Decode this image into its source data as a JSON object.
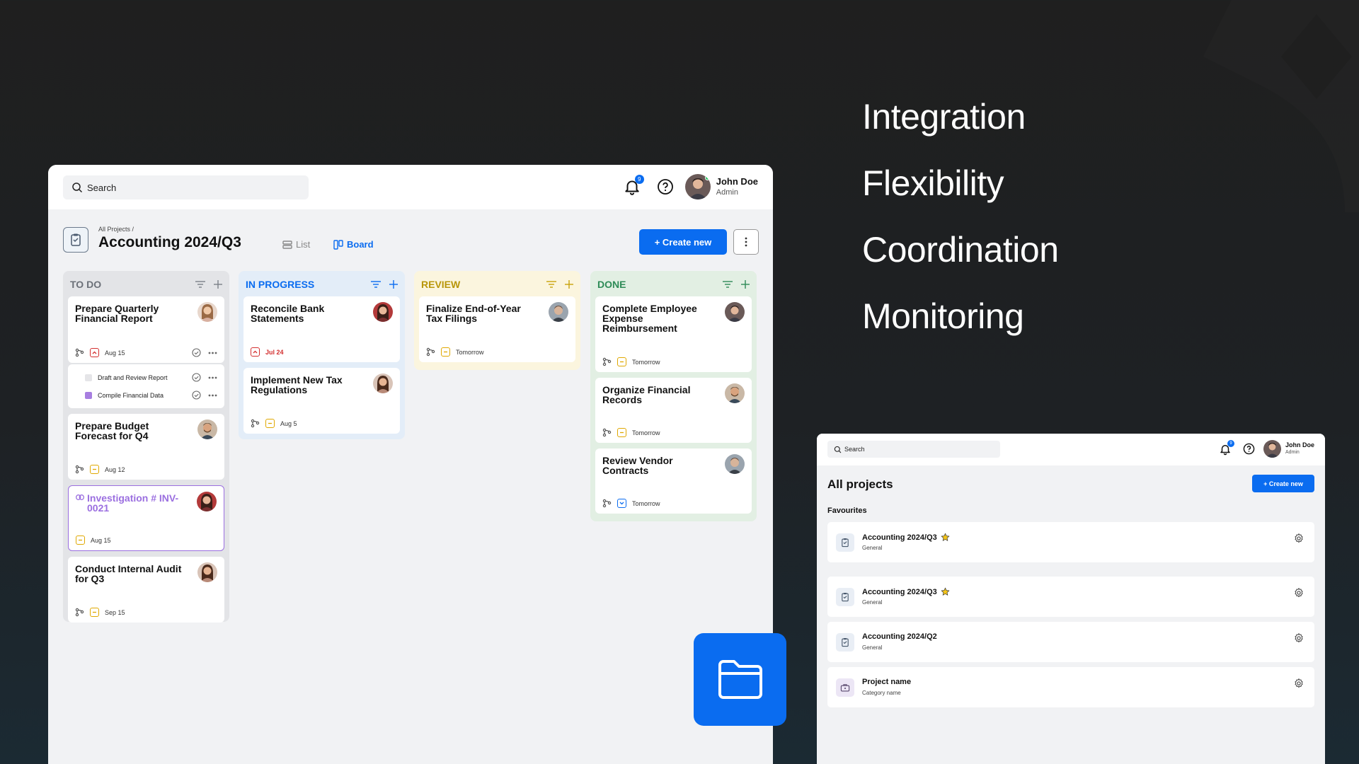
{
  "features": [
    "Integration",
    "Flexibility",
    "Coordination",
    "Monitoring"
  ],
  "colors": {
    "accent": "#0a6cf0",
    "todo": "#8a8f96",
    "in_progress": "#0a6cf0",
    "review": "#b8960a",
    "done": "#2e8b57"
  },
  "main": {
    "search_placeholder": "Search",
    "notifications_count": "9",
    "user": {
      "name": "John Doe",
      "role": "Admin"
    },
    "breadcrumb": "All Projects /",
    "project_title": "Accounting 2024/Q3",
    "views": {
      "list": "List",
      "board": "Board"
    },
    "create_label": "+ Create new",
    "columns": [
      {
        "title": "TO DO",
        "cards": [
          {
            "title": "Prepare Quarterly Financial Report",
            "date": "Aug 15",
            "subtasks": [
              "Draft and Review Report",
              "Compile Financial Data"
            ]
          },
          {
            "title": "Prepare Budget Forecast for Q4",
            "date": "Aug 12"
          },
          {
            "title": "Investigation # INV-0021",
            "date": "Aug 15"
          },
          {
            "title": "Conduct Internal Audit for Q3",
            "date": "Sep 15"
          }
        ]
      },
      {
        "title": "IN PROGRESS",
        "cards": [
          {
            "title": "Reconcile Bank Statements",
            "date": "Jul 24"
          },
          {
            "title": "Implement New Tax Regulations",
            "date": "Aug 5"
          }
        ]
      },
      {
        "title": "REVIEW",
        "cards": [
          {
            "title": "Finalize End-of-Year Tax Filings",
            "date": "Tomorrow"
          }
        ]
      },
      {
        "title": "DONE",
        "cards": [
          {
            "title": "Complete Employee Expense Reimbursement",
            "date": "Tomorrow"
          },
          {
            "title": "Organize Financial Records",
            "date": "Tomorrow"
          },
          {
            "title": "Review Vendor Contracts",
            "date": "Tomorrow"
          }
        ]
      }
    ]
  },
  "secondary": {
    "search_placeholder": "Search",
    "notifications_count": "9",
    "user": {
      "name": "John Doe",
      "role": "Admin"
    },
    "page_title": "All projects",
    "create_label": "+ Create new",
    "favourites_label": "Favourites",
    "projects": [
      {
        "name": "Accounting 2024/Q3",
        "category": "General",
        "starred": true
      },
      {
        "name": "Accounting 2024/Q3",
        "category": "General",
        "starred": true
      },
      {
        "name": "Accounting 2024/Q2",
        "category": "General",
        "starred": false
      },
      {
        "name": "Project name",
        "category": "Category name",
        "starred": false
      }
    ]
  }
}
